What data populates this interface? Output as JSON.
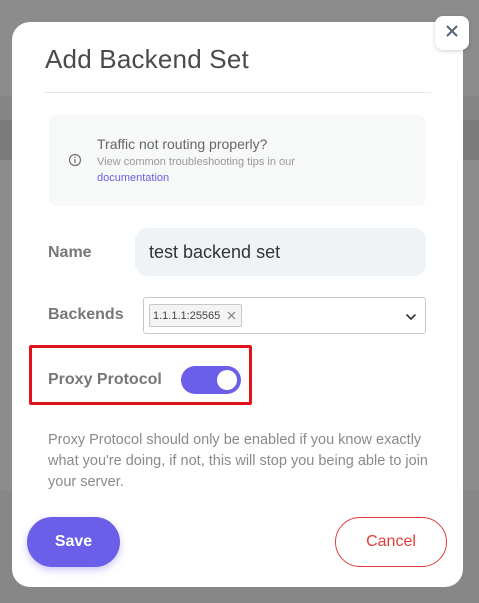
{
  "modal": {
    "title": "Add Backend Set",
    "close_icon": "close-icon"
  },
  "help": {
    "icon": "info-icon",
    "heading": "Traffic not routing properly?",
    "subtext": "View common troubleshooting tips in our",
    "link_label": "documentation"
  },
  "form": {
    "name": {
      "label": "Name",
      "value": "test backend set"
    },
    "backends": {
      "label": "Backends",
      "selected": [
        "1.1.1.1:25565"
      ],
      "chevron_icon": "chevron-down-icon"
    },
    "proxy_protocol": {
      "label": "Proxy Protocol",
      "enabled": true
    }
  },
  "warning": "Proxy Protocol should only be enabled if you know exactly what you're doing, if not, this will stop you being able to join your server.",
  "actions": {
    "save_label": "Save",
    "cancel_label": "Cancel"
  },
  "colors": {
    "accent": "#6b5ee8",
    "danger": "#e23b3b",
    "highlight": "#e0131c"
  }
}
